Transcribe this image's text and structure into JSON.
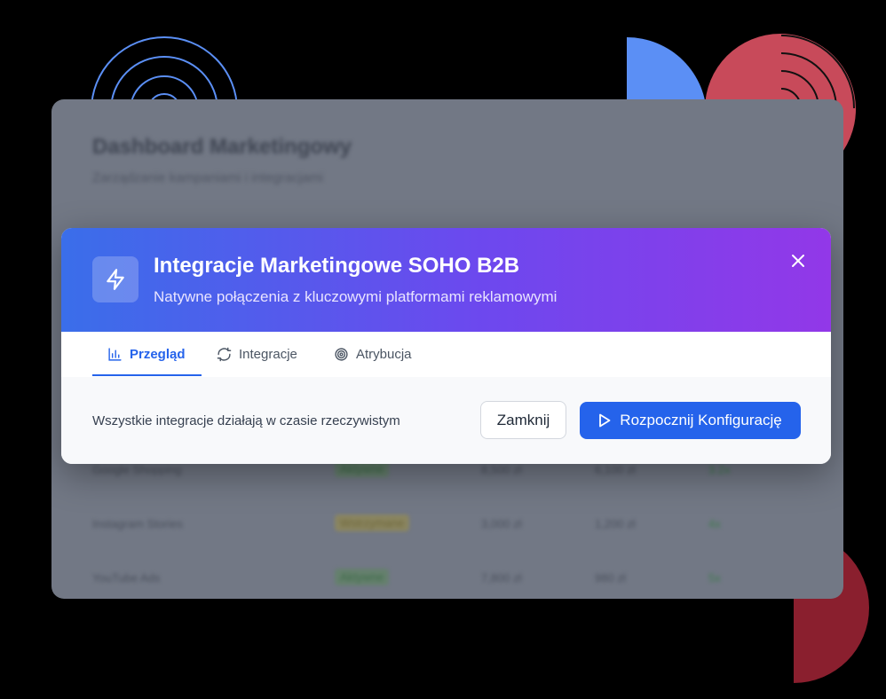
{
  "background": {
    "title": "Dashboard Marketingowy",
    "subtitle": "Zarządzanie kampaniami i integracjami",
    "rows": [
      {
        "name": "Google Shopping",
        "status": "Aktywne",
        "budget": "8,500 zł",
        "spent": "6,100 zł",
        "roi": "3.2x",
        "status_color": "green"
      },
      {
        "name": "Instagram Stories",
        "status": "Wstrzymane",
        "budget": "3,000 zł",
        "spent": "1,200 zł",
        "roi": "4x",
        "status_color": "yellow"
      },
      {
        "name": "YouTube Ads",
        "status": "Aktywne",
        "budget": "7,800 zł",
        "spent": "980 zł",
        "roi": "5x",
        "status_color": "green"
      }
    ]
  },
  "modal": {
    "header_icon": "lightning-icon",
    "title": "Integracje Marketingowe SOHO B2B",
    "subtitle": "Natywne połączenia z kluczowymi platformami reklamowymi",
    "close_icon": "close-icon",
    "gradient": [
      "#3a6eea",
      "#6d48ee",
      "#9238e8"
    ]
  },
  "tabs": [
    {
      "label": "Przegląd",
      "icon": "bar-chart-icon",
      "active": true
    },
    {
      "label": "Integracje",
      "icon": "refresh-icon",
      "active": false
    },
    {
      "label": "Atrybucja",
      "icon": "target-icon",
      "active": false
    }
  ],
  "footer": {
    "status_text": "Wszystkie integracje działają w czasie rzeczywistym",
    "close_button": "Zamknij",
    "start_button": "Rozpocznij Konfigurację",
    "start_icon": "play-icon"
  },
  "colors": {
    "accent": "#2563eb",
    "decor_blue": "#5b8ff5",
    "decor_red": "#c84a5a",
    "decor_dark_red": "#8a1f2e"
  }
}
